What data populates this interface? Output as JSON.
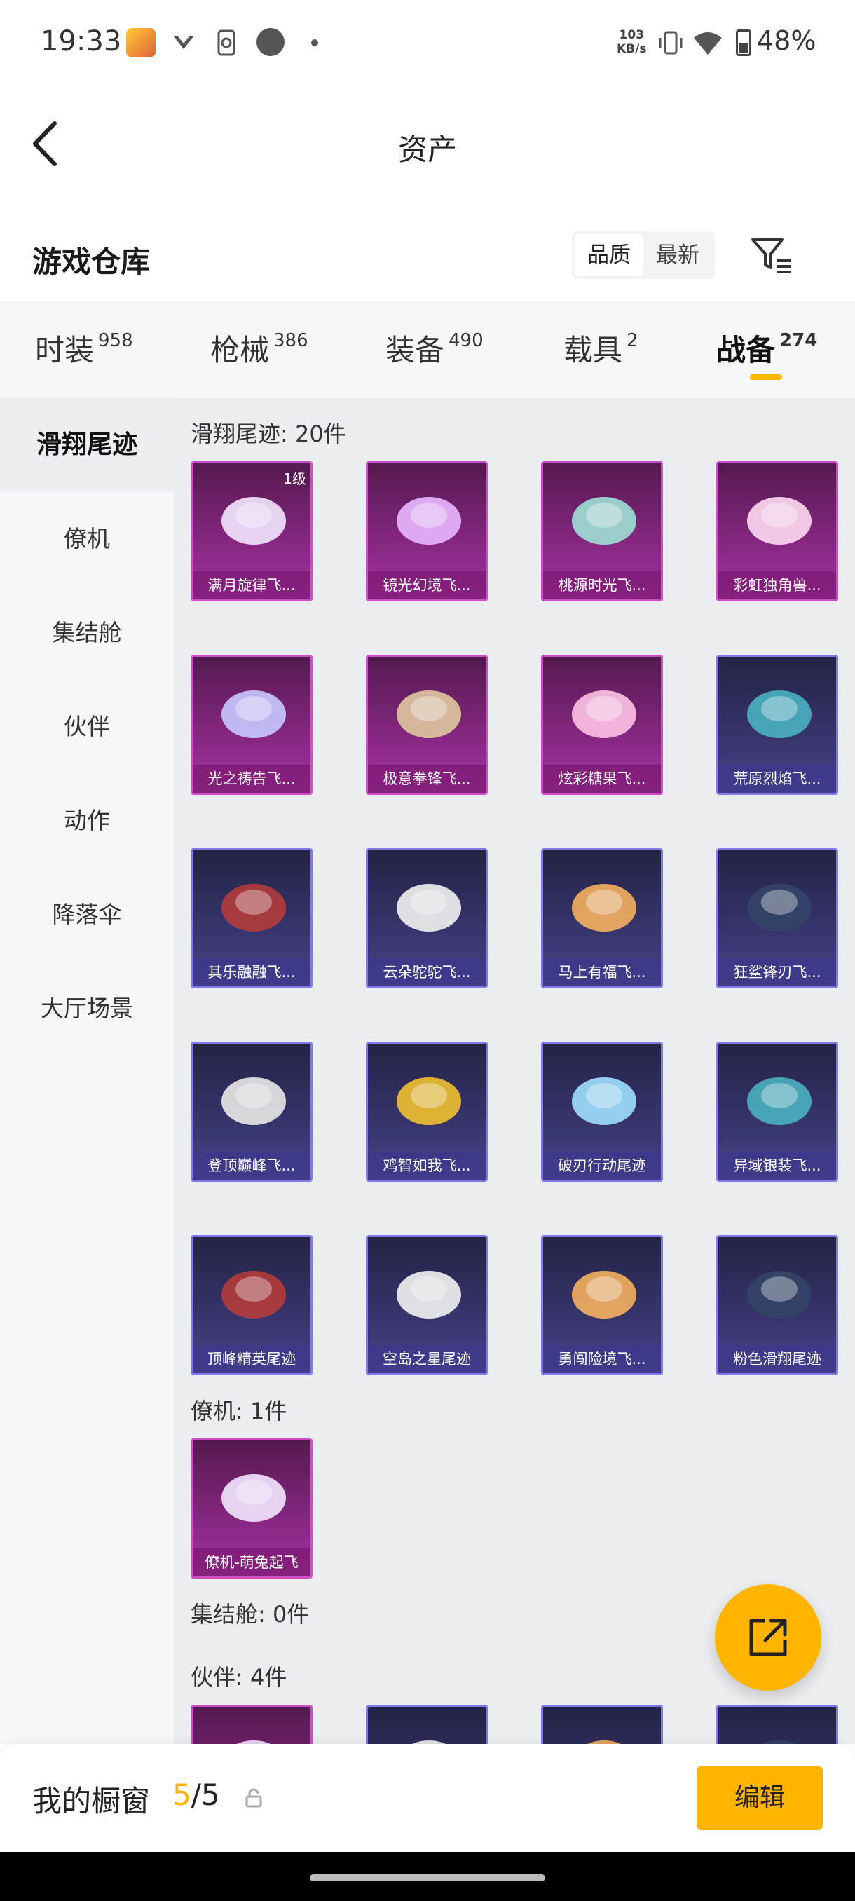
{
  "status_bar": {
    "time": "19:33",
    "speed_value": "103",
    "speed_unit": "KB/s",
    "battery": "48%"
  },
  "header": {
    "title": "资产",
    "back_icon": "chevron-left-icon"
  },
  "warehouse": {
    "title": "游戏仓库",
    "sort_options": [
      "品质",
      "最新"
    ],
    "active_sort": "品质",
    "filter_icon": "filter-icon"
  },
  "category_tabs": [
    {
      "label": "时装",
      "count": "958"
    },
    {
      "label": "枪械",
      "count": "386"
    },
    {
      "label": "装备",
      "count": "490"
    },
    {
      "label": "载具",
      "count": "2"
    },
    {
      "label": "战备",
      "count": "274",
      "active": true
    }
  ],
  "sidebar": [
    {
      "label": "滑翔尾迹",
      "active": true
    },
    {
      "label": "僚机"
    },
    {
      "label": "集结舱"
    },
    {
      "label": "伙伴"
    },
    {
      "label": "动作"
    },
    {
      "label": "降落伞"
    },
    {
      "label": "大厅场景"
    }
  ],
  "sections": {
    "glide_trails": {
      "label": "滑翔尾迹: 20件",
      "items": [
        {
          "name": "满月旋律飞...",
          "rarity": "purple",
          "level": "1级"
        },
        {
          "name": "镜光幻境飞...",
          "rarity": "purple"
        },
        {
          "name": "桃源时光飞...",
          "rarity": "purple"
        },
        {
          "name": "彩虹独角兽...",
          "rarity": "purple"
        },
        {
          "name": "光之祷告飞...",
          "rarity": "purple"
        },
        {
          "name": "极意拳锋飞...",
          "rarity": "purple"
        },
        {
          "name": "炫彩糖果飞...",
          "rarity": "purple"
        },
        {
          "name": "荒原烈焰飞...",
          "rarity": "blue"
        },
        {
          "name": "其乐融融飞...",
          "rarity": "blue"
        },
        {
          "name": "云朵驼驼飞...",
          "rarity": "blue"
        },
        {
          "name": "马上有福飞...",
          "rarity": "blue"
        },
        {
          "name": "狂鲨锋刃飞...",
          "rarity": "blue"
        },
        {
          "name": "登顶巅峰飞...",
          "rarity": "blue"
        },
        {
          "name": "鸡智如我飞...",
          "rarity": "blue"
        },
        {
          "name": "破刃行动尾迹",
          "rarity": "blue"
        },
        {
          "name": "异域银装飞...",
          "rarity": "blue"
        },
        {
          "name": "顶峰精英尾迹",
          "rarity": "blue"
        },
        {
          "name": "空岛之星尾迹",
          "rarity": "blue"
        },
        {
          "name": "勇闯险境飞...",
          "rarity": "blue"
        },
        {
          "name": "粉色滑翔尾迹",
          "rarity": "blue"
        }
      ]
    },
    "wingman": {
      "label": "僚机: 1件",
      "items": [
        {
          "name": "僚机-萌兔起飞",
          "rarity": "purple"
        }
      ]
    },
    "assembly_pod": {
      "label": "集结舱: 0件"
    },
    "partners": {
      "label": "伙伴: 4件",
      "items": [
        {
          "name": "",
          "rarity": "purple"
        },
        {
          "name": "",
          "rarity": "blue"
        },
        {
          "name": "",
          "rarity": "blue"
        },
        {
          "name": "",
          "rarity": "blue"
        }
      ]
    }
  },
  "fab": {
    "icon": "share-external-icon"
  },
  "showcase": {
    "label": "我的橱窗",
    "current": "5",
    "separator": "/",
    "total": "5",
    "lock_icon": "lock-icon",
    "edit_label": "编辑"
  },
  "colors": {
    "accent": "#ffb400",
    "purple_border": "#d04dc9",
    "blue_border": "#8177e6"
  }
}
